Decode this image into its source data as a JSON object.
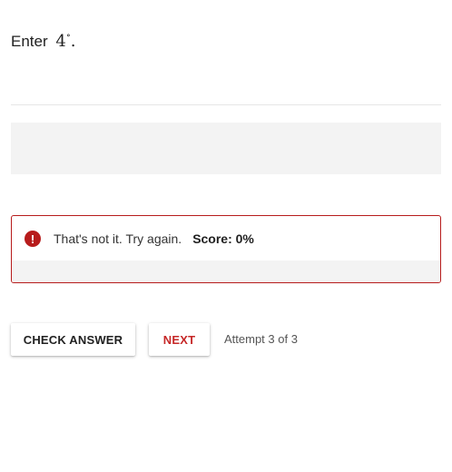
{
  "question": {
    "prefix": "Enter",
    "value": "4",
    "degree_symbol": "∘",
    "suffix": "."
  },
  "answer_input": {
    "value": "",
    "placeholder": ""
  },
  "feedback": {
    "icon": "alert-circle-icon",
    "message": "That's not it. Try again.",
    "score": "Score: 0%",
    "color": "#b71c1c"
  },
  "actions": {
    "check_answer_label": "CHECK ANSWER",
    "next_label": "NEXT",
    "next_color": "#c62828",
    "attempt_text": "Attempt 3 of 3"
  }
}
